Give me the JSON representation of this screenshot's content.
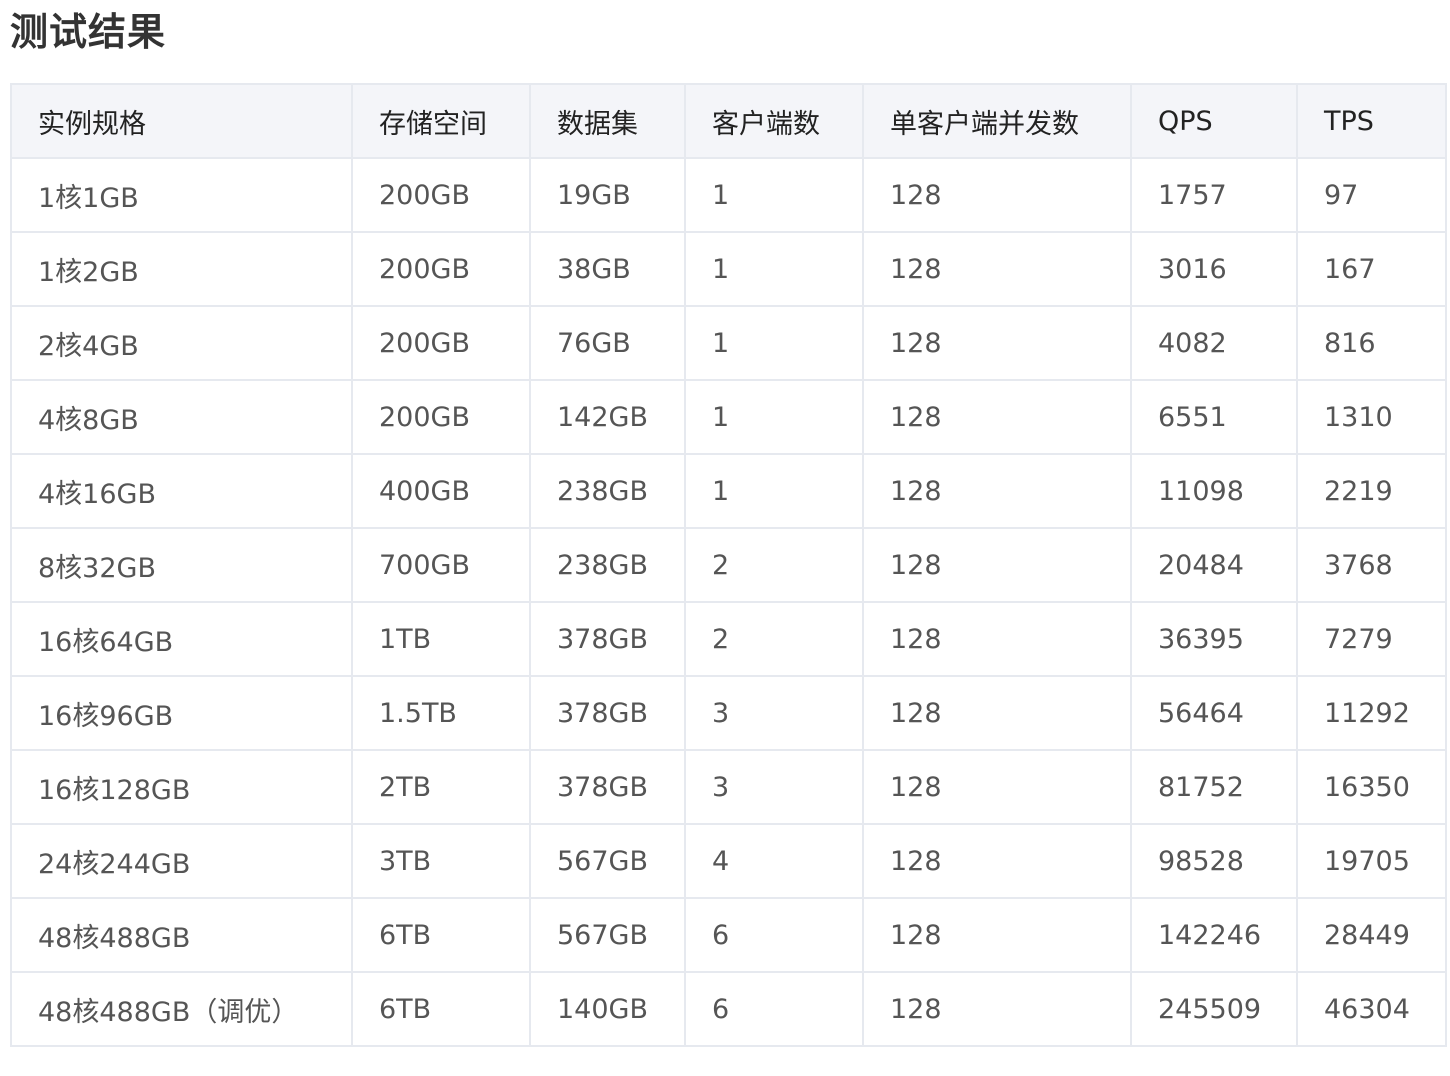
{
  "page": {
    "title": "测试结果"
  },
  "table": {
    "columns": [
      "实例规格",
      "存储空间",
      "数据集",
      "客户端数",
      "单客户端并发数",
      "QPS",
      "TPS"
    ],
    "rows": [
      [
        "1核1GB",
        "200GB",
        "19GB",
        "1",
        "128",
        "1757",
        "97"
      ],
      [
        "1核2GB",
        "200GB",
        "38GB",
        "1",
        "128",
        "3016",
        "167"
      ],
      [
        "2核4GB",
        "200GB",
        "76GB",
        "1",
        "128",
        "4082",
        "816"
      ],
      [
        "4核8GB",
        "200GB",
        "142GB",
        "1",
        "128",
        "6551",
        "1310"
      ],
      [
        "4核16GB",
        "400GB",
        "238GB",
        "1",
        "128",
        "11098",
        "2219"
      ],
      [
        "8核32GB",
        "700GB",
        "238GB",
        "2",
        "128",
        "20484",
        "3768"
      ],
      [
        "16核64GB",
        "1TB",
        "378GB",
        "2",
        "128",
        "36395",
        "7279"
      ],
      [
        "16核96GB",
        "1.5TB",
        "378GB",
        "3",
        "128",
        "56464",
        "11292"
      ],
      [
        "16核128GB",
        "2TB",
        "378GB",
        "3",
        "128",
        "81752",
        "16350"
      ],
      [
        "24核244GB",
        "3TB",
        "567GB",
        "4",
        "128",
        "98528",
        "19705"
      ],
      [
        "48核488GB",
        "6TB",
        "567GB",
        "6",
        "128",
        "142246",
        "28449"
      ],
      [
        "48核488GB（调优）",
        "6TB",
        "140GB",
        "6",
        "128",
        "245509",
        "46304"
      ]
    ]
  }
}
